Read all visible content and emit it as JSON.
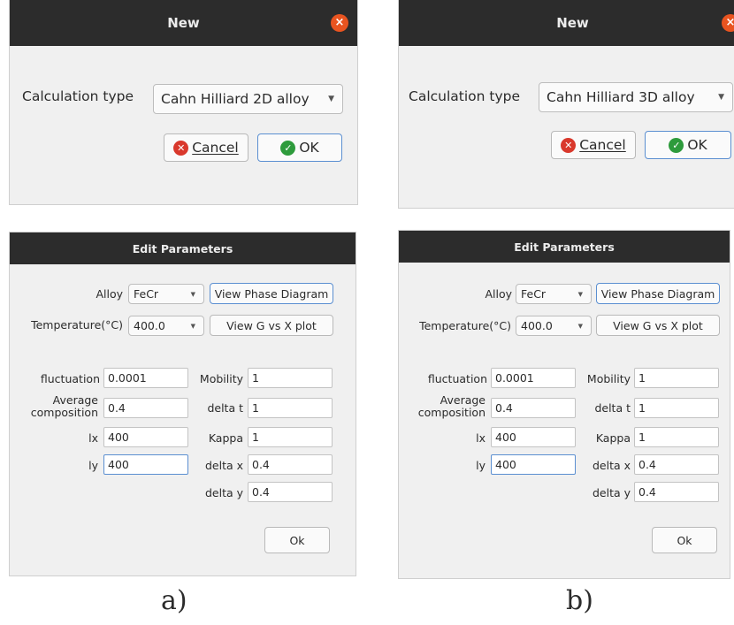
{
  "panels": [
    {
      "caption": "a)",
      "new_dialog": {
        "title": "New",
        "close_glyph": "×",
        "calc_type_label": "Calculation type",
        "calc_type_value": "Cahn Hilliard 2D alloy",
        "cancel_label": "Cancel",
        "ok_label": "OK"
      },
      "edit_dialog": {
        "title": "Edit Parameters",
        "alloy_label": "Alloy",
        "alloy_value": "FeCr",
        "view_phase_diagram": "View Phase Diagram",
        "temperature_label": "Temperature(°C)",
        "temperature_value": "400.0",
        "view_g_vs_x": "View G vs X plot",
        "fluctuation_label": "fluctuation",
        "fluctuation_value": "0.0001",
        "avg_comp_label_1": "Average",
        "avg_comp_label_2": "composition",
        "avg_comp_value": "0.4",
        "lx_label": "lx",
        "lx_value": "400",
        "ly_label": "ly",
        "ly_value": "400",
        "mobility_label": "Mobility",
        "mobility_value": "1",
        "delta_t_label": "delta t",
        "delta_t_value": "1",
        "kappa_label": "Kappa",
        "kappa_value": "1",
        "delta_x_label": "delta x",
        "delta_x_value": "0.4",
        "delta_y_label": "delta y",
        "delta_y_value": "0.4",
        "ok_label": "Ok"
      }
    },
    {
      "caption": "b)",
      "new_dialog": {
        "title": "New",
        "close_glyph": "×",
        "calc_type_label": "Calculation type",
        "calc_type_value": "Cahn Hilliard 3D alloy",
        "cancel_label": "Cancel",
        "ok_label": "OK"
      },
      "edit_dialog": {
        "title": "Edit Parameters",
        "alloy_label": "Alloy",
        "alloy_value": "FeCr",
        "view_phase_diagram": "View Phase Diagram",
        "temperature_label": "Temperature(°C)",
        "temperature_value": "400.0",
        "view_g_vs_x": "View G vs X plot",
        "fluctuation_label": "fluctuation",
        "fluctuation_value": "0.0001",
        "avg_comp_label_1": "Average",
        "avg_comp_label_2": "composition",
        "avg_comp_value": "0.4",
        "lx_label": "lx",
        "lx_value": "400",
        "ly_label": "ly",
        "ly_value": "400",
        "mobility_label": "Mobility",
        "mobility_value": "1",
        "delta_t_label": "delta t",
        "delta_t_value": "1",
        "kappa_label": "Kappa",
        "kappa_value": "1",
        "delta_x_label": "delta x",
        "delta_x_value": "0.4",
        "delta_y_label": "delta y",
        "delta_y_value": "0.4",
        "ok_label": "Ok"
      }
    }
  ]
}
